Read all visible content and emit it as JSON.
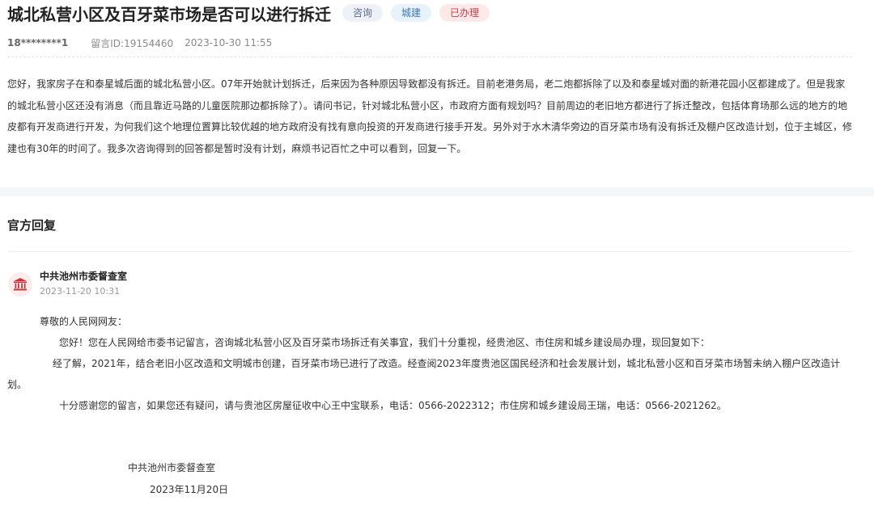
{
  "header": {
    "title": "城北私营小区及百牙菜市场是否可以进行拆迁",
    "tags": {
      "type": "咨询",
      "domain": "城建",
      "status": "已办理"
    }
  },
  "meta": {
    "user": "18********1",
    "message_id": "留言ID:19154460",
    "datetime": "2023-10-30 11:55"
  },
  "message": {
    "content": "您好，我家房子在和泰星城后面的城北私营小区。07年开始就计划拆迁，后来因为各种原因导致都没有拆迁。目前老港务局，老二炮都拆除了以及和泰星城对面的新港花园小区都建成了。但是我家的城北私营小区还没有消息（而且靠近马路的儿童医院那边都拆除了）。请问书记，针对城北私营小区，市政府方面有规划吗？目前周边的老旧地方都进行了拆迁整改，包括体育场那么远的地方的地皮都有开发商进行开发，为何我们这个地理位置算比较优越的地方政府没有找有意向投资的开发商进行接手开发。另外对于水木清华旁边的百牙菜市场有没有拆迁及棚户区改造计划，位于主城区，修建也有30年的时间了。我多次咨询得到的回答都是暂时没有计划，麻烦书记百忙之中可以看到，回复一下。"
  },
  "reply": {
    "section_title": "官方回复",
    "org_icon": "government-building-icon",
    "org_name": "中共池州市委督查室",
    "time": "2023-11-20 10:31",
    "greeting": "尊敬的人民网网友：",
    "paragraphs": [
      "您好！您在人民网给市委书记留言，咨询城北私营小区及百牙菜市场拆迁有关事宜，我们十分重视，经贵池区、市住房和城乡建设局办理，现回复如下：",
      "经了解，2021年，结合老旧小区改造和文明城市创建，百牙菜市场已进行了改造。经查阅2023年度贵池区国民经济和社会发展计划，城北私营小区和百牙菜市场暂未纳入棚户区改造计划。",
      "十分感谢您的留言，如果您还有疑问，请与贵池区房屋征收中心王中宝联系，电话：0566-2022312；市住房和城乡建设局王瑞，电话：0566-2021262。"
    ],
    "signature_org": "中共池州市委督查室",
    "signature_date": "2023年11月20日"
  },
  "colors": {
    "status_red": "#d33a45",
    "domain_blue": "#3d79b8",
    "avatar_red": "#c9353f"
  }
}
